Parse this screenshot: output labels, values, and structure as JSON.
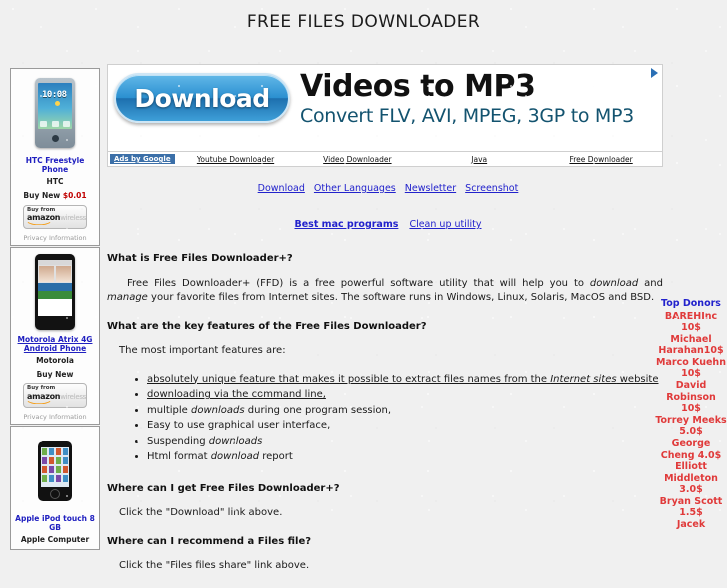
{
  "page": {
    "title": "FREE FILES DOWNLOADER"
  },
  "banner_ad": {
    "button_label": "Download",
    "headline": "Videos to MP3",
    "subline": "Convert FLV, AVI, MPEG, 3GP to MP3",
    "adchoices_icon": "adchoices-triangle-icon",
    "ads_by_label": "Ads by Google",
    "links": [
      "Youtube Downloader",
      "Video Downloader",
      "Java",
      "Free Downloader"
    ]
  },
  "nav": {
    "primary": [
      "Download",
      "Other Languages",
      "Newsletter",
      "Screenshot"
    ],
    "secondary": [
      {
        "label": "Best mac programs",
        "bold": true
      },
      {
        "label": "Clean up utility",
        "bold": false
      }
    ]
  },
  "article": {
    "h1": "What is Free Files Downloader+?",
    "p1_a": "Free Files Downloader+ (FFD) is a free powerful software utility that will help you to ",
    "p1_em1": "download",
    "p1_b": " and ",
    "p1_em2": "manage",
    "p1_c": " your favorite files from Internet sites. The software runs in Windows, Linux, Solaris, MacOS and BSD.",
    "h2": "What are the key features of the Free Files Downloader?",
    "p2": "The most important features are:",
    "features": [
      {
        "a": "absolutely unique feature that makes it possible to extract files names from the ",
        "em": "Internet sites",
        "b": " website",
        "underline": true
      },
      {
        "a": "downloading via the command line,",
        "em": "",
        "b": "",
        "underline": true
      },
      {
        "a": "multiple ",
        "em": "downloads",
        "b": " during one program session,",
        "underline": false
      },
      {
        "a": "Easy to use graphical user interface,",
        "em": "",
        "b": "",
        "underline": false
      },
      {
        "a": "Suspending ",
        "em": "downloads",
        "b": "",
        "underline": false
      },
      {
        "a": "Html format ",
        "em": "download",
        "b": " report",
        "underline": false
      }
    ],
    "h3": "Where can I get Free Files Downloader+?",
    "p3": "Click the \"Download\" link above.",
    "h4": "Where can I recommend a Files file?",
    "p4": "Click the \"Files files share\" link above."
  },
  "left_ads": [
    {
      "image": "htc-freestyle-phone-image",
      "title": "HTC Freestyle Phone",
      "title_underline": false,
      "brand": "HTC",
      "price_label": "Buy New ",
      "price_amount": "$0.01",
      "button_buy_from": "Buy from",
      "button_amazon": "amazon",
      "button_wireless": "wireless",
      "privacy": "Privacy Information"
    },
    {
      "image": "motorola-atrix-phone-image",
      "title": "Motorola Atrix 4G Android Phone",
      "title_underline": true,
      "brand": "Motorola",
      "price_label": "Buy New",
      "price_amount": "",
      "button_buy_from": "Buy from",
      "button_amazon": "amazon",
      "button_wireless": "wireless",
      "privacy": "Privacy Information"
    },
    {
      "image": "apple-ipod-touch-image",
      "title": "Apple iPod touch 8 GB",
      "title_underline": false,
      "brand": "Apple Computer",
      "price_label": "",
      "price_amount": "",
      "button_buy_from": "",
      "button_amazon": "",
      "button_wireless": "",
      "privacy": ""
    }
  ],
  "donors": {
    "title": "Top Donors",
    "entries": [
      "BAREHInc 10$",
      "Michael Harahan10$",
      "Marco Kuehn   10$",
      "David Robinson 10$",
      "Torrey Meeks 5.0$",
      "George Cheng 4.0$",
      "Elliott Middleton 3.0$",
      "Bryan Scott 1.5$",
      "Jacek"
    ]
  },
  "colors": {
    "link": "#2222cc",
    "donor_red": "#e03a3a",
    "price_red": "#c00000",
    "ads_blue": "#3b6fa8",
    "page_bg": "#f0f0f0"
  }
}
